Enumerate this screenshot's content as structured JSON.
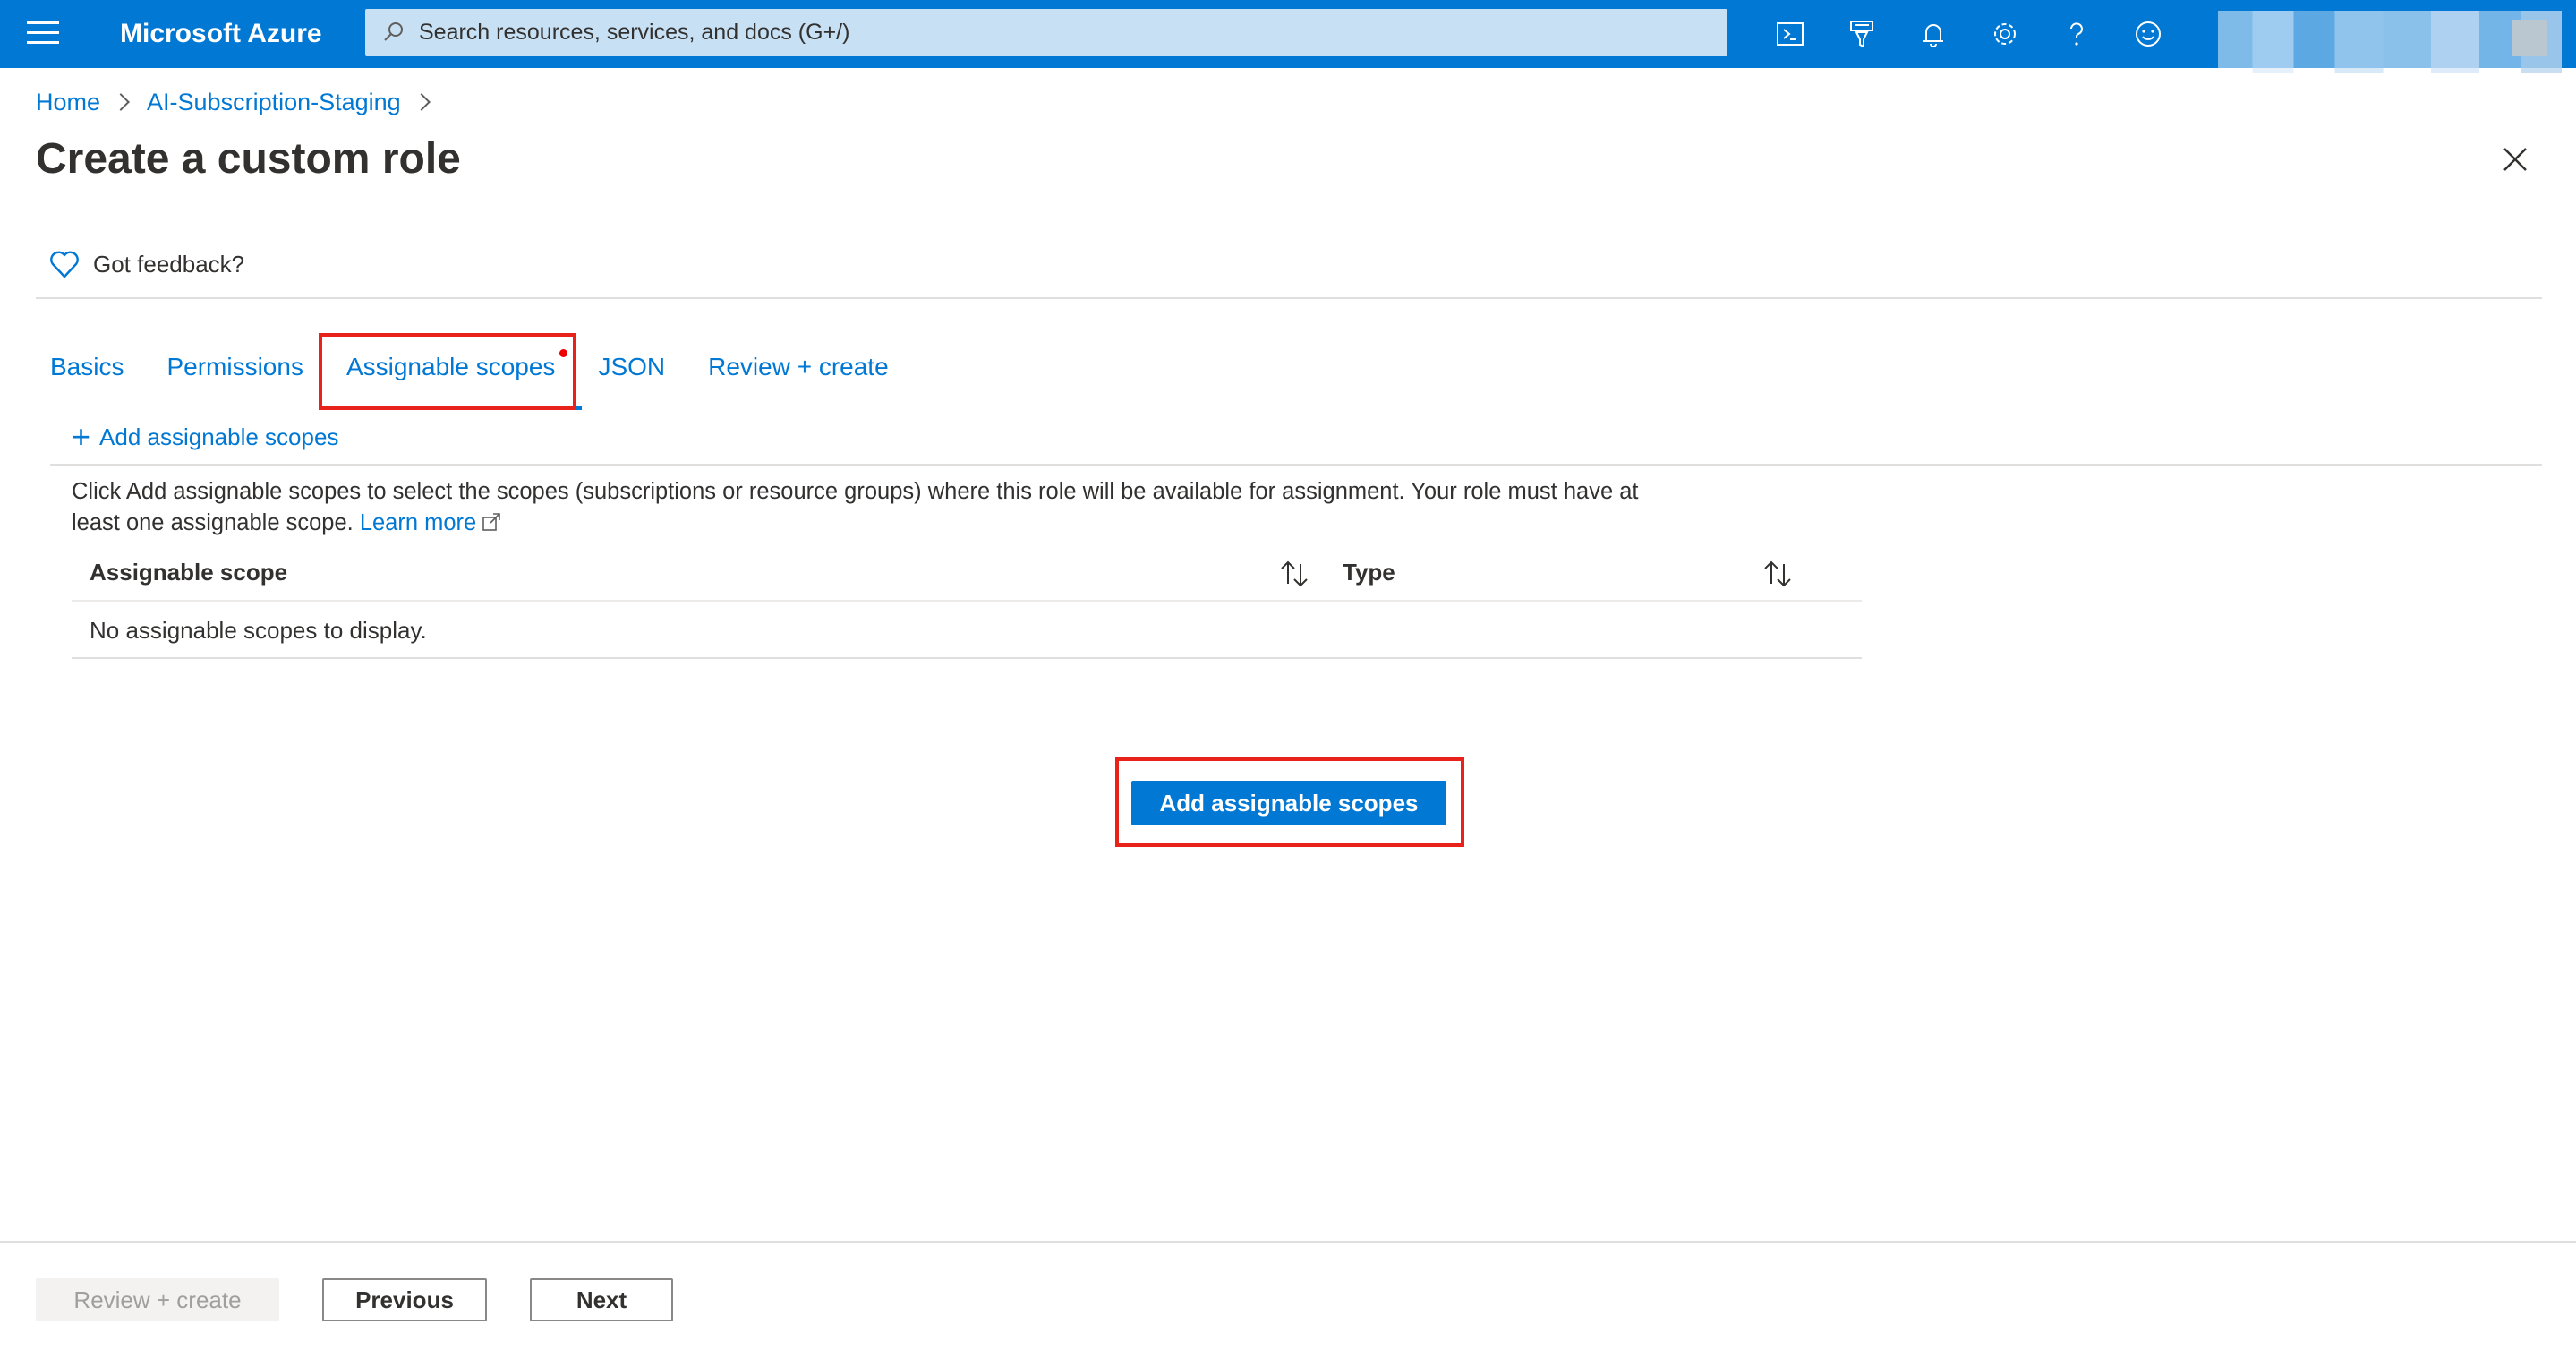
{
  "topbar": {
    "brand": "Microsoft Azure",
    "search_placeholder": "Search resources, services, and docs (G+/)",
    "icons": [
      "cloud-shell-icon",
      "directory-filter-icon",
      "bell-icon",
      "gear-icon",
      "help-icon",
      "feedback-smiley-icon"
    ],
    "accent_color": "#0078d4"
  },
  "breadcrumb": {
    "items": [
      "Home",
      "AI-Subscription-Staging"
    ]
  },
  "page": {
    "title": "Create a custom role"
  },
  "feedback": {
    "label": "Got feedback?"
  },
  "tabs": [
    {
      "label": "Basics",
      "active": false
    },
    {
      "label": "Permissions",
      "active": false
    },
    {
      "label": "Assignable scopes",
      "active": true
    },
    {
      "label": "JSON",
      "active": false
    },
    {
      "label": "Review + create",
      "active": false
    }
  ],
  "toolbar": {
    "add_label": "Add assignable scopes"
  },
  "description": {
    "text": "Click Add assignable scopes to select the scopes (subscriptions or resource groups) where this role will be available for assignment. Your role must have at least one assignable scope.",
    "learn_more": "Learn more"
  },
  "table": {
    "columns": [
      "Assignable scope",
      "Type"
    ],
    "empty_message": "No assignable scopes to display."
  },
  "center_button": {
    "label": "Add assignable scopes"
  },
  "footer": {
    "review_label": "Review + create",
    "previous_label": "Previous",
    "next_label": "Next"
  },
  "colors": {
    "highlight": "#e8221a",
    "link": "#0078d4"
  }
}
